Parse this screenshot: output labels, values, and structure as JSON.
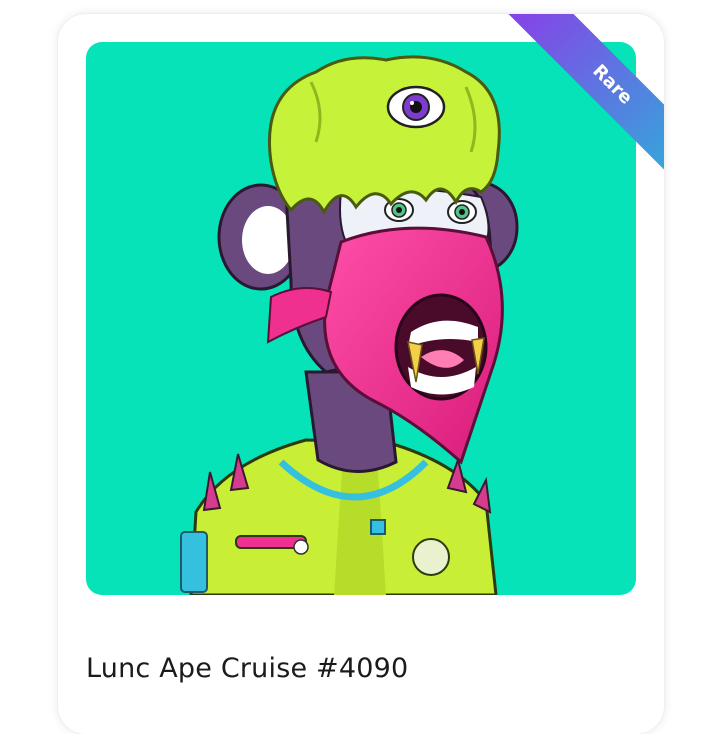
{
  "card": {
    "title": "Lunc Ape Cruise #4090",
    "badge": "Rare",
    "image_alt": "ape-nft-artwork"
  },
  "colors": {
    "background_teal": "#06e3b8",
    "ribbon_start": "#8a3ee8",
    "ribbon_end": "#2bb3d9",
    "hat_green": "#c6f23a",
    "mask_pink": "#f0308f",
    "fur_purple": "#6a4a7e",
    "jacket_green": "#c8ef35"
  }
}
